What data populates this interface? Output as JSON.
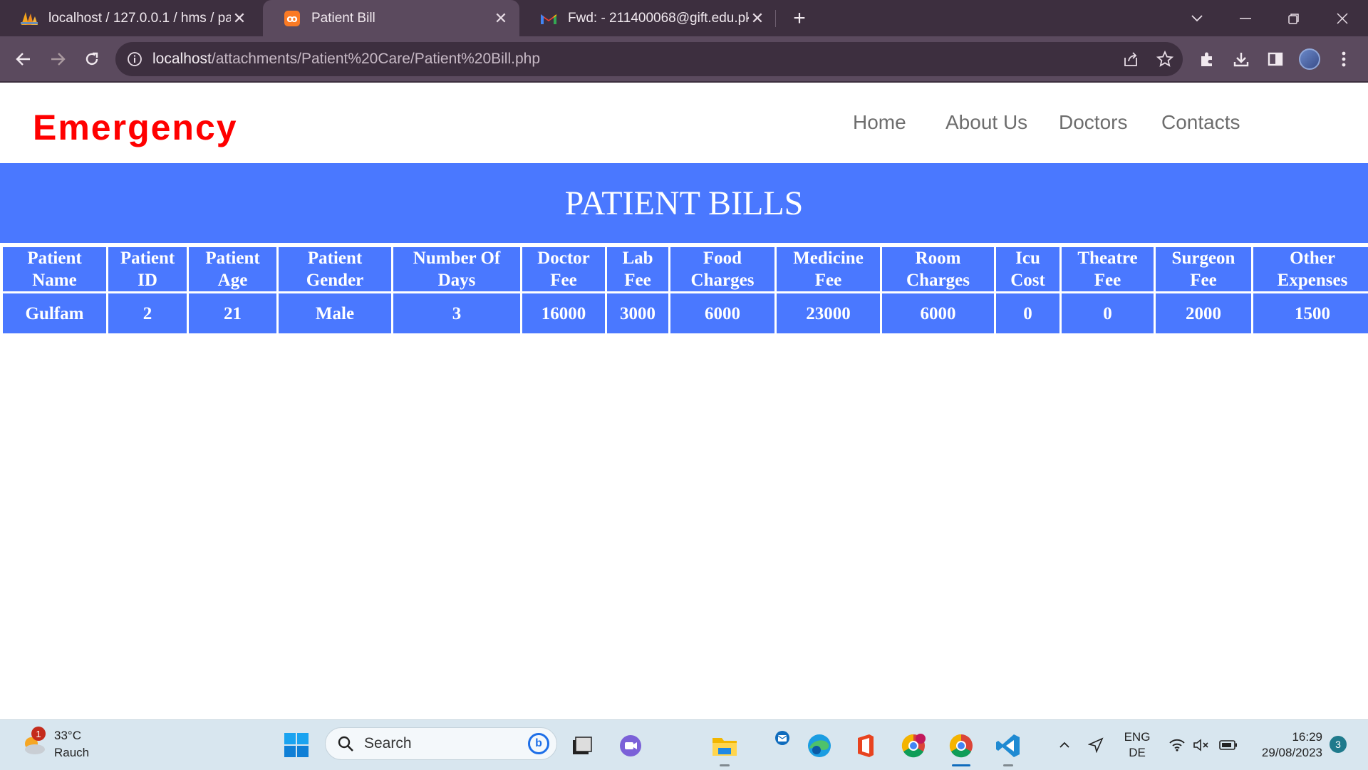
{
  "browser": {
    "tabs": [
      {
        "title": "localhost / 127.0.0.1 / hms / patie",
        "icon": "phpmyadmin-icon",
        "active": false
      },
      {
        "title": "Patient Bill",
        "icon": "xampp-icon",
        "active": true
      },
      {
        "title": "Fwd: - 211400068@gift.edu.pk - ",
        "icon": "gmail-icon",
        "active": false
      }
    ],
    "url_host": "localhost",
    "url_path": "/attachments/Patient%20Care/Patient%20Bill.php"
  },
  "site": {
    "brand": "Emergency",
    "nav": [
      "Home",
      "About Us",
      "Doctors",
      "Contacts"
    ]
  },
  "banner": {
    "title": "PATIENT BILLS"
  },
  "bills_table": {
    "headers": [
      [
        "Patient",
        "Name"
      ],
      [
        "Patient",
        "ID"
      ],
      [
        "Patient",
        "Age"
      ],
      [
        "Patient",
        "Gender"
      ],
      [
        "Number Of",
        "Days"
      ],
      [
        "Doctor",
        "Fee"
      ],
      [
        "Lab",
        "Fee"
      ],
      [
        "Food",
        "Charges"
      ],
      [
        "Medicine",
        "Fee"
      ],
      [
        "Room",
        "Charges"
      ],
      [
        "Icu",
        "Cost"
      ],
      [
        "Theatre",
        "Fee"
      ],
      [
        "Surgeon",
        "Fee"
      ],
      [
        "Other",
        "Expenses"
      ]
    ],
    "rows": [
      [
        "Gulfam",
        "2",
        "21",
        "Male",
        "3",
        "16000",
        "3000",
        "6000",
        "23000",
        "6000",
        "0",
        "0",
        "2000",
        "1500"
      ]
    ]
  },
  "taskbar": {
    "weather": {
      "temp": "33°C",
      "condition": "Rauch",
      "badge": "1"
    },
    "search_label": "Search",
    "lang": {
      "line1": "ENG",
      "line2": "DE"
    },
    "clock": {
      "time": "16:29",
      "date": "29/08/2023"
    },
    "notifications": "3"
  },
  "colors": {
    "brand": "#ff0000",
    "banner": "#4a78ff",
    "nav": "#6d6d6d"
  }
}
